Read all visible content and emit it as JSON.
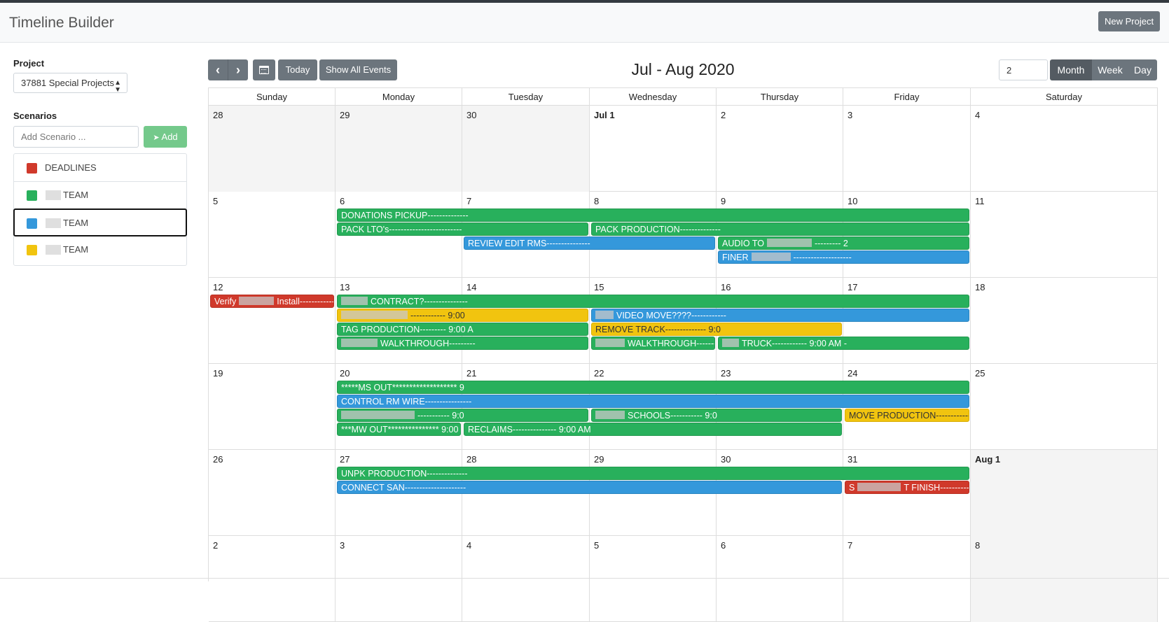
{
  "app": {
    "title": "Timeline Builder",
    "new_project_label": "New Project"
  },
  "sidebar": {
    "project_label": "Project",
    "project_value": "37881 Special Projects",
    "scenarios_label": "Scenarios",
    "add_scenario_placeholder": "Add Scenario ...",
    "add_label": "Add",
    "scenarios": [
      {
        "name": "DEADLINES",
        "color": "#d0392b",
        "redacted": false,
        "selected": false
      },
      {
        "name": "TEAM",
        "color": "#28b05c",
        "redacted": true,
        "selected": false
      },
      {
        "name": "TEAM",
        "color": "#3498db",
        "redacted": true,
        "selected": true
      },
      {
        "name": "TEAM",
        "color": "#f1c40f",
        "redacted": true,
        "selected": false
      }
    ]
  },
  "toolbar": {
    "prev_icon": "chevron-left-icon",
    "next_icon": "chevron-right-icon",
    "calendar_icon": "calendar-icon",
    "today_label": "Today",
    "show_all_label": "Show All Events",
    "title": "Jul - Aug 2020",
    "count_value": "2",
    "views": [
      "Month",
      "Week",
      "Day"
    ],
    "active_view": "Month"
  },
  "colors": {
    "green": "#28b05c",
    "blue": "#3498db",
    "yellow": "#f1c40f",
    "red": "#d0392b"
  },
  "calendar": {
    "weekdays": [
      "Sunday",
      "Monday",
      "Tuesday",
      "Wednesday",
      "Thursday",
      "Friday",
      "Saturday"
    ],
    "weeks": [
      {
        "days": [
          {
            "label": "28",
            "other": true
          },
          {
            "label": "29",
            "other": true
          },
          {
            "label": "30",
            "other": true
          },
          {
            "label": "Jul 1",
            "other": false,
            "first": true
          },
          {
            "label": "2",
            "other": false
          },
          {
            "label": "3",
            "other": false
          },
          {
            "label": "4",
            "other": false
          }
        ],
        "events": []
      },
      {
        "days": [
          {
            "label": "5"
          },
          {
            "label": "6"
          },
          {
            "label": "7"
          },
          {
            "label": "8"
          },
          {
            "label": "9"
          },
          {
            "label": "10"
          },
          {
            "label": "11"
          }
        ],
        "events": [
          {
            "text": "DONATIONS PICKUP--------------",
            "color": "green",
            "start": 1,
            "span": 5,
            "row": 0
          },
          {
            "text": "PACK LTO's-------------------------",
            "color": "green",
            "start": 1,
            "span": 2,
            "row": 1
          },
          {
            "text": "PACK PRODUCTION--------------",
            "color": "green",
            "start": 3,
            "span": 3,
            "row": 1
          },
          {
            "text": "REVIEW EDIT RMS---------------",
            "color": "blue",
            "start": 2,
            "span": 2,
            "row": 2
          },
          {
            "text": "AUDIO TO",
            "after": "--------- 2",
            "redact": 64,
            "color": "green",
            "start": 4,
            "span": 2,
            "row": 2
          },
          {
            "text": "FINER",
            "after": "--------------------",
            "redact": 56,
            "color": "blue",
            "start": 4,
            "span": 2,
            "row": 3
          }
        ]
      },
      {
        "days": [
          {
            "label": "12"
          },
          {
            "label": "13"
          },
          {
            "label": "14"
          },
          {
            "label": "15"
          },
          {
            "label": "16"
          },
          {
            "label": "17"
          },
          {
            "label": "18"
          }
        ],
        "events": [
          {
            "text": "Verify",
            "after": "Install------------",
            "redact": 50,
            "color": "red",
            "start": 0,
            "span": 1,
            "row": 0
          },
          {
            "text": "",
            "after": "CONTRACT?---------------",
            "redact": 38,
            "color": "green",
            "start": 1,
            "span": 5,
            "row": 0
          },
          {
            "text": "",
            "after": "------------ 9:00",
            "redact": 95,
            "color": "yellow",
            "start": 1,
            "span": 2,
            "row": 1
          },
          {
            "text": "",
            "after": "VIDEO MOVE????------------",
            "redact": 26,
            "color": "blue",
            "start": 3,
            "span": 3,
            "row": 1
          },
          {
            "text": "TAG PRODUCTION--------- 9:00 A",
            "color": "green",
            "start": 1,
            "span": 2,
            "row": 2
          },
          {
            "text": "REMOVE TRACK-------------- 9:0",
            "color": "yellow",
            "start": 3,
            "span": 2,
            "row": 2
          },
          {
            "text": "",
            "after": "WALKTHROUGH---------",
            "redact": 52,
            "color": "green",
            "start": 1,
            "span": 2,
            "row": 3
          },
          {
            "text": "",
            "after": "WALKTHROUGH--------",
            "redact": 42,
            "color": "green",
            "start": 3,
            "span": 1,
            "row": 3
          },
          {
            "text": "",
            "after": "TRUCK------------ 9:00 AM -",
            "redact": 24,
            "color": "green",
            "start": 4,
            "span": 2,
            "row": 3
          }
        ]
      },
      {
        "days": [
          {
            "label": "19"
          },
          {
            "label": "20"
          },
          {
            "label": "21"
          },
          {
            "label": "22"
          },
          {
            "label": "23"
          },
          {
            "label": "24"
          },
          {
            "label": "25"
          }
        ],
        "events": [
          {
            "text": "*****MS OUT******************* 9",
            "color": "green",
            "start": 1,
            "span": 5,
            "row": 0
          },
          {
            "text": "CONTROL RM WIRE----------------",
            "color": "blue",
            "start": 1,
            "span": 5,
            "row": 1
          },
          {
            "text": "",
            "after": "----------- 9:0",
            "redact": 105,
            "color": "green",
            "start": 1,
            "span": 2,
            "row": 2
          },
          {
            "text": "",
            "after": "SCHOOLS----------- 9:0",
            "redact": 42,
            "color": "green",
            "start": 3,
            "span": 2,
            "row": 2
          },
          {
            "text": "MOVE PRODUCTION--------------",
            "color": "yellow",
            "start": 5,
            "span": 1,
            "row": 2
          },
          {
            "text": "***MW OUT*************** 9:00 A",
            "color": "green",
            "start": 1,
            "span": 1,
            "row": 3
          },
          {
            "text": "RECLAIMS--------------- 9:00 AM",
            "color": "green",
            "start": 2,
            "span": 3,
            "row": 3
          }
        ]
      },
      {
        "days": [
          {
            "label": "26"
          },
          {
            "label": "27"
          },
          {
            "label": "28"
          },
          {
            "label": "29"
          },
          {
            "label": "30"
          },
          {
            "label": "31"
          },
          {
            "label": "Aug 1",
            "other": true,
            "first": true
          }
        ],
        "events": [
          {
            "text": "UNPK PRODUCTION--------------",
            "color": "green",
            "start": 1,
            "span": 5,
            "row": 0
          },
          {
            "text": "CONNECT SAN---------------------",
            "color": "blue",
            "start": 1,
            "span": 4,
            "row": 1
          },
          {
            "text": "S",
            "after": "T FINISH-------------",
            "redact": 62,
            "color": "red",
            "start": 5,
            "span": 1,
            "row": 1
          }
        ]
      },
      {
        "days": [
          {
            "label": "2"
          },
          {
            "label": "3"
          },
          {
            "label": "4"
          },
          {
            "label": "5"
          },
          {
            "label": "6"
          },
          {
            "label": "7"
          },
          {
            "label": "8",
            "other": true
          }
        ],
        "events": []
      }
    ]
  }
}
